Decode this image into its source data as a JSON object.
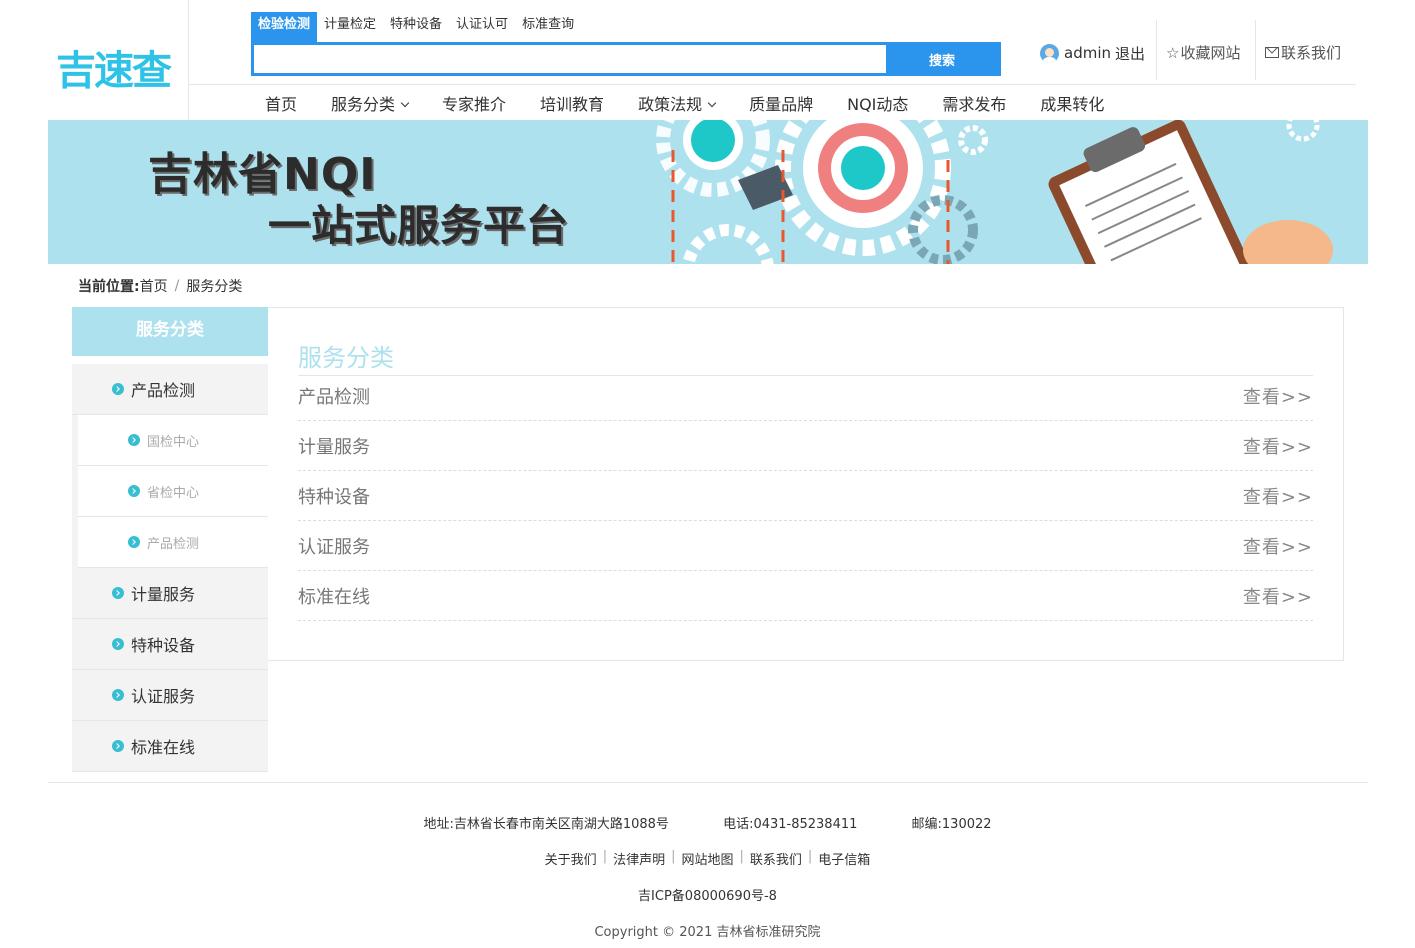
{
  "logo": "吉速查",
  "search": {
    "tabs": [
      "检验检测",
      "计量检定",
      "特种设备",
      "认证认可",
      "标准查询"
    ],
    "placeholder": "",
    "button": "搜索"
  },
  "user": {
    "name": "admin",
    "logout": "退出",
    "favorite": "收藏网站",
    "contact": "联系我们"
  },
  "nav": [
    "首页",
    "服务分类",
    "专家推介",
    "培训教育",
    "政策法规",
    "质量品牌",
    "NQI动态",
    "需求发布",
    "成果转化"
  ],
  "banner": {
    "line1": "吉林省NQI",
    "line2": "一站式服务平台"
  },
  "breadcrumb": {
    "label": "当前位置:",
    "home": "首页",
    "sep": "/",
    "current": "服务分类"
  },
  "sidebar": {
    "title": "服务分类",
    "items": [
      {
        "label": "产品检测",
        "level": 1
      },
      {
        "label": "国检中心",
        "level": 2
      },
      {
        "label": "省检中心",
        "level": 2
      },
      {
        "label": "产品检测",
        "level": 2
      },
      {
        "label": "计量服务",
        "level": 1
      },
      {
        "label": "特种设备",
        "level": 1
      },
      {
        "label": "认证服务",
        "level": 1
      },
      {
        "label": "标准在线",
        "level": 1
      }
    ]
  },
  "content": {
    "title": "服务分类",
    "rows": [
      {
        "name": "产品检测",
        "more": "查看>>"
      },
      {
        "name": "计量服务",
        "more": "查看>>"
      },
      {
        "name": "特种设备",
        "more": "查看>>"
      },
      {
        "name": "认证服务",
        "more": "查看>>"
      },
      {
        "name": "标准在线",
        "more": "查看>>"
      }
    ]
  },
  "footer": {
    "address": "地址:吉林省长春市南关区南湖大路1088号",
    "phone": "电话:0431-85238411",
    "postcode": "邮编:130022",
    "links": [
      "关于我们",
      "法律声明",
      "网站地图",
      "联系我们",
      "电子信箱"
    ],
    "icp": "吉ICP备08000690号-8",
    "copyright": "Copyright © 2021 吉林省标准研究院"
  },
  "colors": {
    "accent": "#2b95ee",
    "light_cyan": "#aee1ee",
    "bullet": "#37bed0",
    "logo": "#2ec3e6"
  }
}
